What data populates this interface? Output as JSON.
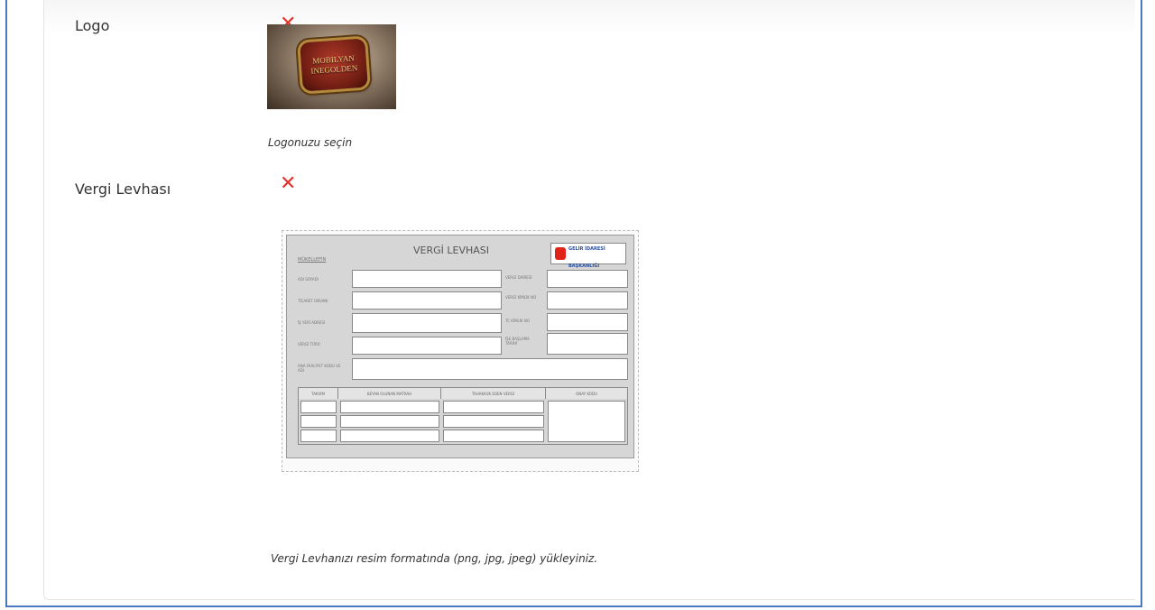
{
  "form": {
    "logo": {
      "label": "Logo",
      "remove_icon": "close-icon",
      "image_text_line1": "MOBILYAN",
      "image_text_line2": "INEGOLDEN",
      "help": "Logonuzu seçin"
    },
    "vergi": {
      "label": "Vergi Levhası",
      "remove_icon": "close-icon",
      "help": "Vergi Levhanızı resim formatında (png, jpg, jpeg) yükleyiniz.",
      "preview": {
        "title": "VERGİ LEVHASI",
        "owner": "MÜKELLEFİN",
        "issuer_line1": "GELİR İDARESİ",
        "issuer_line2": "BAŞKANLIĞI",
        "left_fields": [
          "ADI SOYADI",
          "TİCARET ÜNVANI",
          "İŞ YERİ ADRESİ",
          "VERGİ TÜRÜ"
        ],
        "right_fields": [
          "VERGİ DAİRESİ",
          "VERGİ KİMLİK NO",
          "TC KİMLİK NO",
          "İŞE BAŞLAMA TARİHİ"
        ],
        "activity_label": "ANA FAALİYET KODU VE ADI",
        "table_headers": [
          "TAKVİM",
          "BEYAN OLUNAN MATRAH",
          "TAHAKKUK EDEN VERGİ",
          "ONAY KODU"
        ]
      }
    }
  },
  "colors": {
    "accent_border": "#4a78c2",
    "remove": "#e0342c"
  }
}
